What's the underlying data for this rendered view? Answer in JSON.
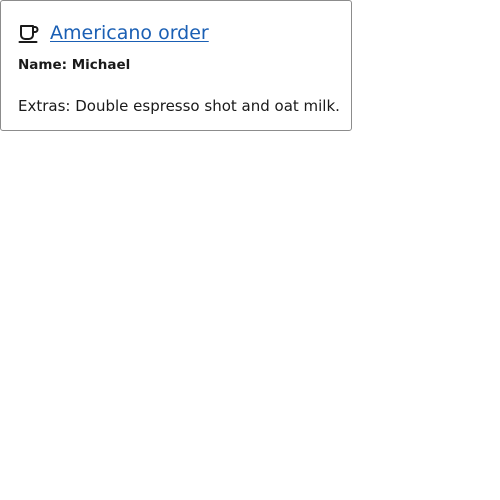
{
  "card": {
    "icon": "coffee-cup-icon",
    "title": "Americano order",
    "name_label": "Name:",
    "name_value": "Michael",
    "extras_label": "Extras:",
    "extras_value": "Double espresso shot and oat milk."
  },
  "colors": {
    "link": "#1a5fb4",
    "border": "#8c8c8c",
    "text": "#1a1a1a"
  }
}
